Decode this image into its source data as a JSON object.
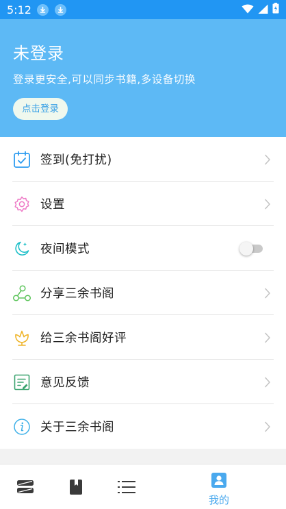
{
  "status_bar": {
    "time": "5:12",
    "icons": [
      "download-icon",
      "download-icon",
      "wifi-icon",
      "signal-icon",
      "battery-icon"
    ]
  },
  "header": {
    "title": "未登录",
    "subtitle": "登录更安全,可以同步书籍,多设备切换",
    "login_button": "点击登录"
  },
  "menu": {
    "items": [
      {
        "label": "签到(免打扰)",
        "icon": "calendar-check-icon",
        "accessory": "chevron"
      },
      {
        "label": "设置",
        "icon": "gear-icon",
        "accessory": "chevron"
      },
      {
        "label": "夜间模式",
        "icon": "moon-icon",
        "accessory": "toggle",
        "toggle_on": false
      },
      {
        "label": "分享三余书阁",
        "icon": "share-icon",
        "accessory": "chevron"
      },
      {
        "label": "给三余书阁好评",
        "icon": "flower-icon",
        "accessory": "chevron"
      },
      {
        "label": "意见反馈",
        "icon": "feedback-icon",
        "accessory": "chevron"
      },
      {
        "label": "关于三余书阁",
        "icon": "info-icon",
        "accessory": "chevron"
      }
    ]
  },
  "bottom_nav": {
    "items": [
      {
        "icon": "bookshelf-icon",
        "label": ""
      },
      {
        "icon": "book-icon",
        "label": ""
      },
      {
        "icon": "list-icon",
        "label": ""
      },
      {
        "icon": "profile-icon",
        "label": "我的",
        "active": true
      }
    ]
  },
  "colors": {
    "status_bar": "#2196f3",
    "header": "#5db9f5",
    "accent": "#4aa9ee",
    "chevron": "#c4c4c4"
  }
}
